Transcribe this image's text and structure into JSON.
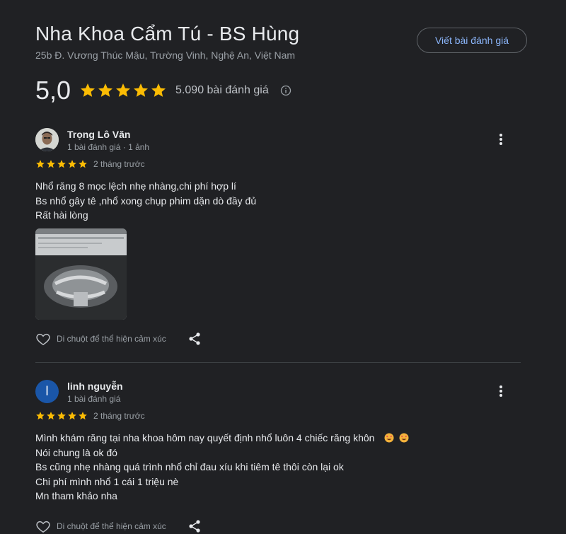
{
  "business": {
    "name": "Nha Khoa Cẩm Tú - BS Hùng",
    "address": "25b Đ. Vương Thúc Mậu, Trường Vinh, Nghệ An, Việt Nam",
    "write_review_label": "Viết bài đánh giá",
    "rating": "5,0",
    "stars": 5,
    "review_count": "5.090 bài đánh giá"
  },
  "reviews": [
    {
      "name": "Trọng Lô Văn",
      "meta": "1 bài đánh giá · 1 ảnh",
      "stars": 5,
      "time": "2 tháng trước",
      "text": "Nhổ răng 8 mọc lệch nhẹ nhàng,chi phí hợp lí\nBs nhổ gây tê ,nhổ xong chụp phim dặn dò đầy đủ\nRất hài lòng",
      "like_label": "Di chuột để thể hiện cảm xúc"
    },
    {
      "name": "linh nguyễn",
      "avatar_letter": "l",
      "meta": "1 bài đánh giá",
      "stars": 5,
      "time": "2 tháng trước",
      "text": "Mình khám răng tại nha khoa hôm nay quyết định nhổ luôn 4 chiếc răng khôn\nNói chung là ok đó\nBs cũng nhẹ nhàng quá trình nhổ chỉ đau xíu khi tiêm tê thôi còn lại ok\nChi phí mình nhổ 1 cái 1 triệu nè\nMn tham khảo nha",
      "like_label": "Di chuột để thể hiện cảm xúc"
    }
  ],
  "colors": {
    "star": "#fbbc04",
    "link": "#8ab4f8",
    "background": "#202124"
  }
}
